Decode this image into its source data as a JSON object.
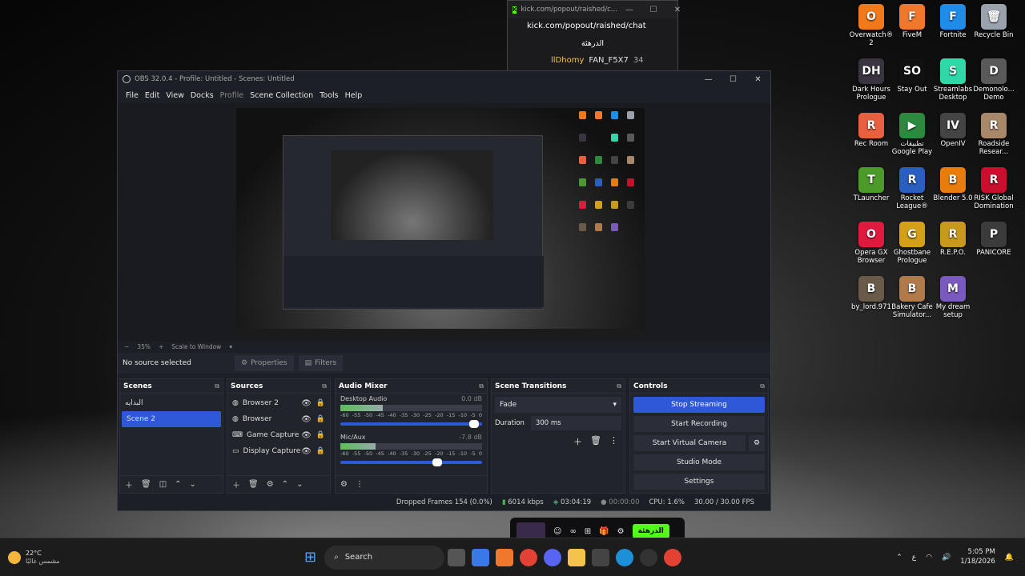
{
  "desktop": {
    "icons": [
      {
        "label": "Overwatch® 2",
        "color": "#f07a1a",
        "glyph": "O"
      },
      {
        "label": "FiveM",
        "color": "#f0782d",
        "glyph": "F"
      },
      {
        "label": "Fortnite",
        "color": "#1e8ce8",
        "glyph": "F"
      },
      {
        "label": "Recycle Bin",
        "color": "#9aa3ad",
        "glyph": "🗑"
      },
      {
        "label": "Dark Hours Prologue",
        "color": "#3a3340",
        "glyph": "DH"
      },
      {
        "label": "Stay Out",
        "color": "#111111",
        "glyph": "SO"
      },
      {
        "label": "Streamlabs Desktop",
        "color": "#2fd8a6",
        "glyph": "S"
      },
      {
        "label": "Demonolo... Demo",
        "color": "#595959",
        "glyph": "D"
      },
      {
        "label": "Rec Room",
        "color": "#e8603f",
        "glyph": "R"
      },
      {
        "label": "تطبيقات Google Play",
        "color": "#2b8a3e",
        "glyph": "▶"
      },
      {
        "label": "OpenIV",
        "color": "#444444",
        "glyph": "IV"
      },
      {
        "label": "Roadside Resear...",
        "color": "#a9886a",
        "glyph": "R"
      },
      {
        "label": "TLauncher",
        "color": "#4c9a2a",
        "glyph": "T"
      },
      {
        "label": "Rocket League®",
        "color": "#2a5fbf",
        "glyph": "R"
      },
      {
        "label": "Blender 5.0",
        "color": "#e87d0d",
        "glyph": "B"
      },
      {
        "label": "RISK Global Domination",
        "color": "#c8102e",
        "glyph": "R"
      },
      {
        "label": "Opera GX Browser",
        "color": "#e0193e",
        "glyph": "O"
      },
      {
        "label": "Ghostbane Prologue",
        "color": "#d4a017",
        "glyph": "G"
      },
      {
        "label": "R.E.P.O.",
        "color": "#c89a1b",
        "glyph": "R"
      },
      {
        "label": "PANICORE",
        "color": "#3b3b3b",
        "glyph": "P"
      },
      {
        "label": "by_lord.971",
        "color": "#6a5a4a",
        "glyph": "B"
      },
      {
        "label": "Bakery Cafe Simulator...",
        "color": "#b07a4a",
        "glyph": "B"
      },
      {
        "label": "My dream setup",
        "color": "#7a5abf",
        "glyph": "M"
      }
    ]
  },
  "kick": {
    "tab_url": "kick.com/popout/raished/c...",
    "url": "kick.com/popout/raished/chat",
    "title": "الدرهئة",
    "user1": "llDhomy",
    "user2": "FAN_F5X7",
    "count": "34"
  },
  "obs": {
    "title": "OBS 32.0.4 - Profile: Untitled - Scenes: Untitled",
    "menu": [
      "File",
      "Edit",
      "View",
      "Docks",
      "Profile",
      "Scene Collection",
      "Tools",
      "Help"
    ],
    "zoom": "35%",
    "scale_mode": "Scale to Window",
    "no_source": "No source selected",
    "properties": "Properties",
    "filters": "Filters",
    "scenes": {
      "header": "Scenes",
      "items": [
        "البدايه",
        "Scene 2"
      ]
    },
    "sources": {
      "header": "Sources",
      "items": [
        {
          "label": "Browser 2",
          "icon": "globe-icon"
        },
        {
          "label": "Browser",
          "icon": "globe-icon"
        },
        {
          "label": "Game Capture",
          "icon": "gamepad-icon"
        },
        {
          "label": "Display Capture",
          "icon": "monitor-icon"
        }
      ]
    },
    "mixer": {
      "header": "Audio Mixer",
      "channels": [
        {
          "name": "Desktop Audio",
          "db": "0.0 dB",
          "level": 0.3,
          "volume": 0.98
        },
        {
          "name": "Mic/Aux",
          "db": "-7.8 dB",
          "level": 0.25,
          "volume": 0.72
        }
      ],
      "scale": [
        "-60",
        "-55",
        "-50",
        "-45",
        "-40",
        "-35",
        "-30",
        "-25",
        "-20",
        "-15",
        "-10",
        "-5",
        "0"
      ]
    },
    "transitions": {
      "header": "Scene Transitions",
      "selected": "Fade",
      "duration_label": "Duration",
      "duration": "300 ms"
    },
    "controls": {
      "header": "Controls",
      "stop_streaming": "Stop Streaming",
      "start_recording": "Start Recording",
      "virtual_cam": "Start Virtual Camera",
      "studio_mode": "Studio Mode",
      "settings": "Settings"
    },
    "status": {
      "dropped": "Dropped Frames 154 (0.0%)",
      "bitrate": "6014 kbps",
      "stream_time": "03:04:19",
      "rec_time": "00:00:00",
      "cpu": "CPU: 1.6%",
      "fps": "30.00 / 30.00 FPS"
    }
  },
  "overlay": {
    "button": "الدرهئة"
  },
  "taskbar": {
    "weather_temp": "22°C",
    "weather_desc": "مشمس غالبًا",
    "search": "Search",
    "time": "5:05 PM",
    "date": "1/18/2026",
    "lang": "ع"
  }
}
